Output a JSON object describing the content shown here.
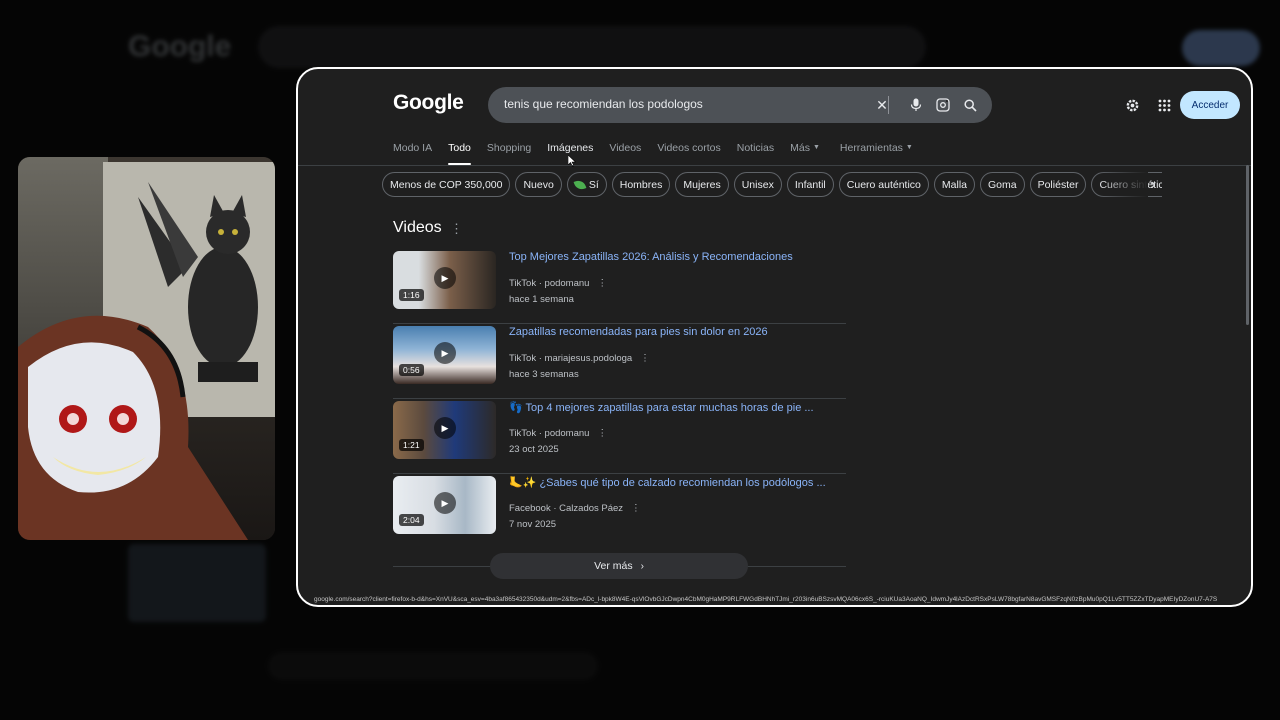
{
  "background": {
    "logo": "Google"
  },
  "panel": {
    "logo": "Google",
    "search": {
      "query": "tenis que recomiendan los podologos",
      "clear_icon": "close-icon",
      "voice_icon": "mic-icon",
      "lens_icon": "lens-icon",
      "search_icon": "search-icon"
    },
    "header": {
      "settings_icon": "gear-icon",
      "apps_icon": "apps-grid-icon",
      "signin_label": "Acceder"
    },
    "tabs": [
      {
        "label": "Modo IA"
      },
      {
        "label": "Todo"
      },
      {
        "label": "Shopping"
      },
      {
        "label": "Imágenes"
      },
      {
        "label": "Videos"
      },
      {
        "label": "Videos cortos"
      },
      {
        "label": "Noticias"
      },
      {
        "label": "Más"
      },
      {
        "label": "Herramientas"
      }
    ],
    "active_tab": "Todo",
    "chips": [
      {
        "label": "Menos de COP 350,000"
      },
      {
        "label": "Nuevo"
      },
      {
        "label": "Sí"
      },
      {
        "label": "Hombres"
      },
      {
        "label": "Mujeres"
      },
      {
        "label": "Unisex"
      },
      {
        "label": "Infantil"
      },
      {
        "label": "Cuero auténtico"
      },
      {
        "label": "Malla"
      },
      {
        "label": "Goma"
      },
      {
        "label": "Poliéster"
      },
      {
        "label": "Cuero sintético"
      }
    ],
    "videos": {
      "section_title": "Videos",
      "items": [
        {
          "title": "Top Mejores Zapatillas 2026: Análisis y Recomendaciones",
          "source": "TikTok · podomanu",
          "date": "hace 1 semana",
          "duration": "1:16",
          "thumb_color": "#6a5f55"
        },
        {
          "title": "Zapatillas recomendadas para pies sin dolor en 2026",
          "source": "TikTok · mariajesus.podologa",
          "date": "hace 3 semanas",
          "duration": "0:56",
          "thumb_color": "#4a7fb0"
        },
        {
          "title": "👣 Top 4 mejores zapatillas para estar muchas horas de pie ...",
          "source": "TikTok · podomanu",
          "date": "23 oct 2025",
          "duration": "1:21",
          "thumb_color": "#5b4a3e"
        },
        {
          "title": "🦶✨ ¿Sabes qué tipo de calzado recomiendan los podólogos ...",
          "source": "Facebook · Calzados Páez",
          "date": "7 nov 2025",
          "duration": "2:04",
          "thumb_color": "#d8dde3"
        }
      ],
      "more_label": "Ver más"
    },
    "status_url": "google.com/search?client=firefox-b-d&hs=XnVU&sca_esv=4ba3af865432350d&udm=2&fbs=ADc_l-bpk8W4E-qsVlOvbGJcDwpn4CbM0gHaMP9RLFWGdBHNhTJmi_r203in6uBSzsvMQA06cx6S_-rciuKUa3AoaNQ_IdwmJy4lAzDctRSxPsLW78bgfarN8avGMSFzqN0zBpMu0pQ1Lv5TT5ZZxTDyapMEIyDZonU7-A7S"
  }
}
